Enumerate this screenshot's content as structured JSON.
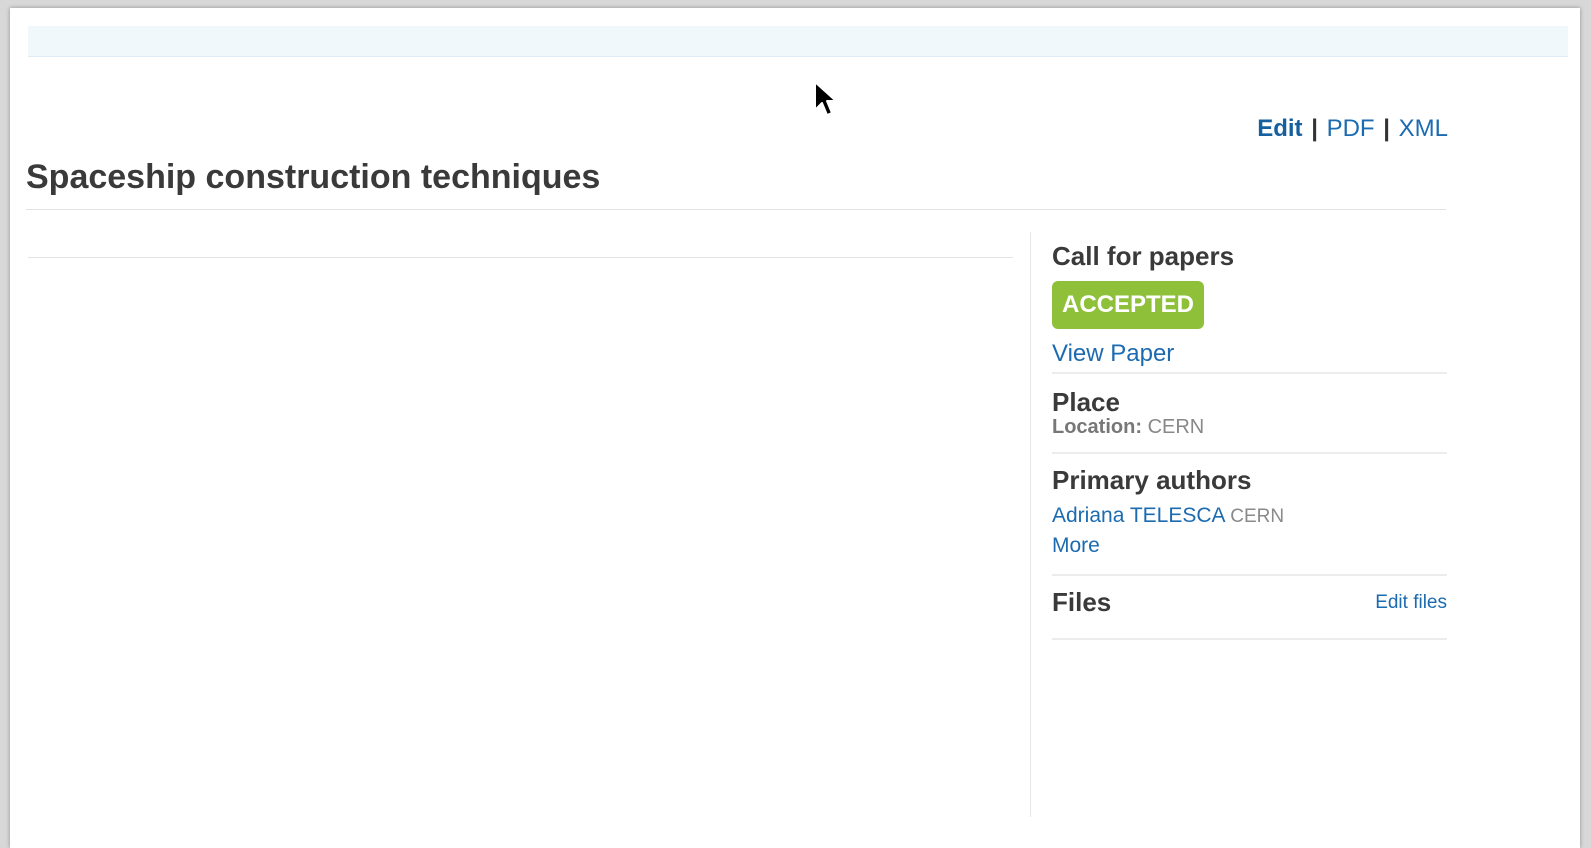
{
  "header": {
    "actions": {
      "edit": "Edit",
      "pdf": "PDF",
      "xml": "XML",
      "separator": "|"
    },
    "title": "Spaceship construction techniques"
  },
  "sidebar": {
    "call_for_papers": {
      "title": "Call for papers",
      "status": "ACCEPTED",
      "view_paper": "View Paper"
    },
    "place": {
      "title": "Place",
      "location_label": "Location:",
      "location_value": "CERN"
    },
    "primary_authors": {
      "title": "Primary authors",
      "authors": [
        {
          "name": "Adriana TELESCA",
          "affiliation": "CERN"
        }
      ],
      "more": "More"
    },
    "files": {
      "title": "Files",
      "edit_files": "Edit files"
    }
  },
  "colors": {
    "link": "#1c6bb0",
    "accepted_badge": "#8fc03a",
    "title_text": "#3a3a3a",
    "top_strip": "#f1f8fc"
  },
  "icons": {
    "cursor": "mouse-pointer-icon"
  }
}
